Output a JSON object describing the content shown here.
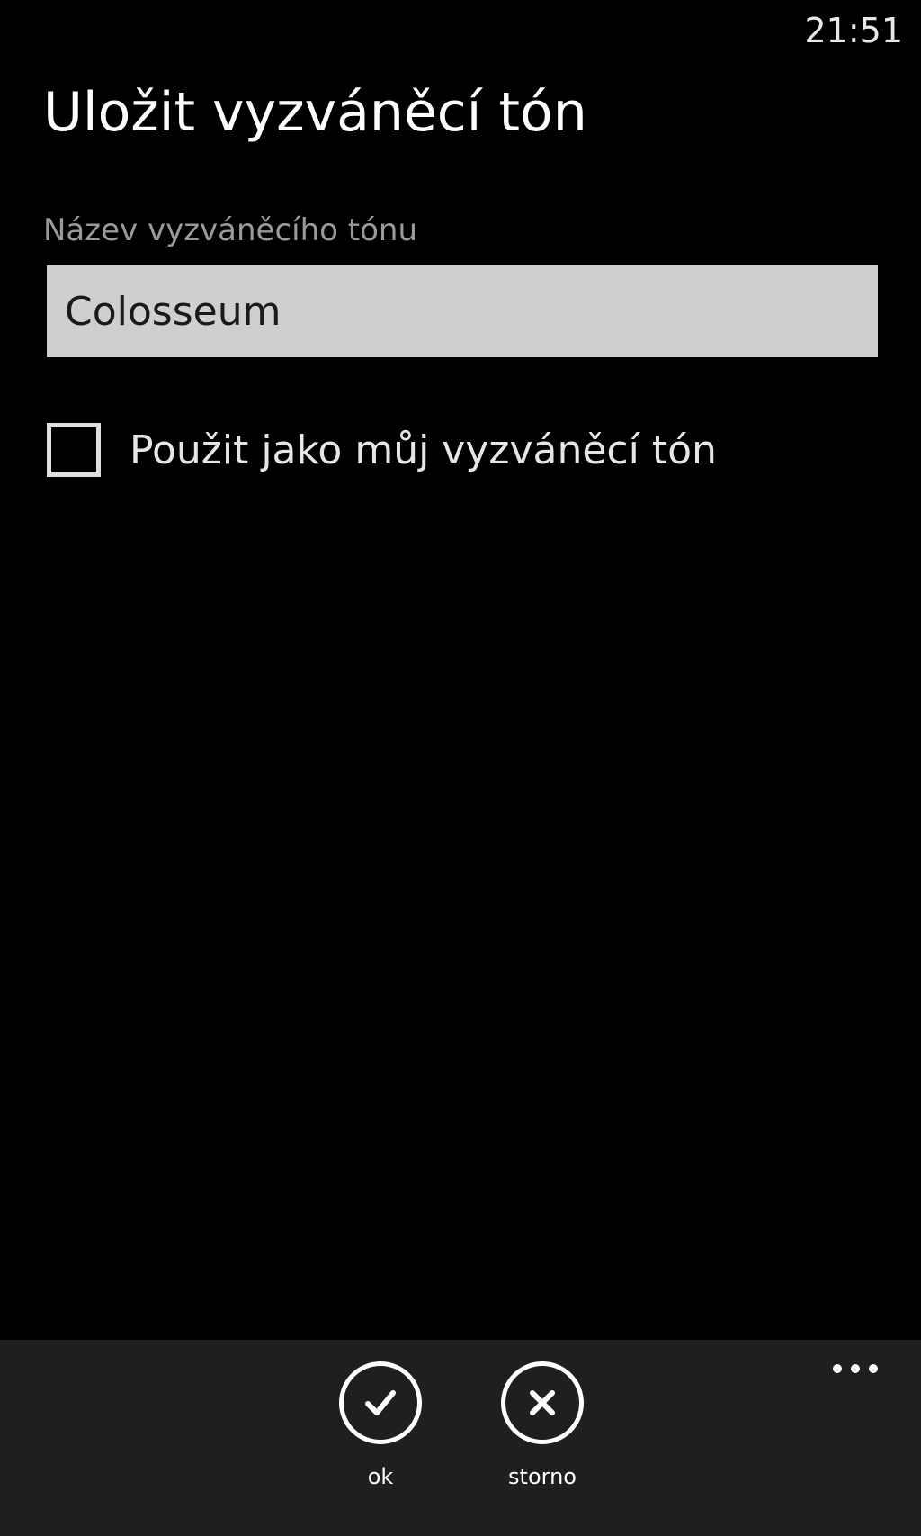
{
  "status_bar": {
    "time": "21:51"
  },
  "page": {
    "title": "Uložit vyzváněcí tón"
  },
  "form": {
    "name_label": "Název vyzváněcího tónu",
    "name_value": "Colosseum",
    "checkbox_label": "Použit jako můj vyzváněcí tón",
    "checkbox_checked": false
  },
  "app_bar": {
    "background": "#1f1f1f",
    "more_icon": "ellipsis-icon",
    "buttons": [
      {
        "label": "ok",
        "icon": "checkmark-icon"
      },
      {
        "label": "storno",
        "icon": "close-icon"
      }
    ]
  }
}
